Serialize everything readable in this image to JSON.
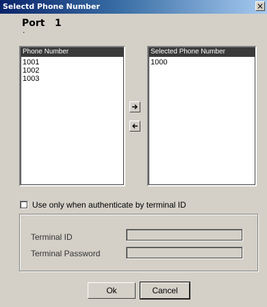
{
  "window": {
    "title": "Selectd Phone Number",
    "close_glyph": "×"
  },
  "port": {
    "label": "Port",
    "value": "1",
    "dot": "."
  },
  "available_list": {
    "header": "Phone Number",
    "items": [
      "1001",
      "1002",
      "1003"
    ]
  },
  "selected_list": {
    "header": "Selected Phone Number",
    "items": [
      "1000"
    ]
  },
  "move_buttons": {
    "add_glyph": "➔",
    "remove_glyph": "🡐"
  },
  "auth": {
    "checkbox_label": "Use only when authenticate by terminal ID",
    "checked": false,
    "terminal_id_label": "Terminal ID",
    "terminal_id_value": "",
    "terminal_password_label": "Terminal Password",
    "terminal_password_value": ""
  },
  "buttons": {
    "ok": "Ok",
    "cancel": "Cancel"
  },
  "colors": {
    "title_start": "#0a246a",
    "title_end": "#a6caf0",
    "face": "#d4d0c8",
    "list_header": "#3a3a3a"
  }
}
